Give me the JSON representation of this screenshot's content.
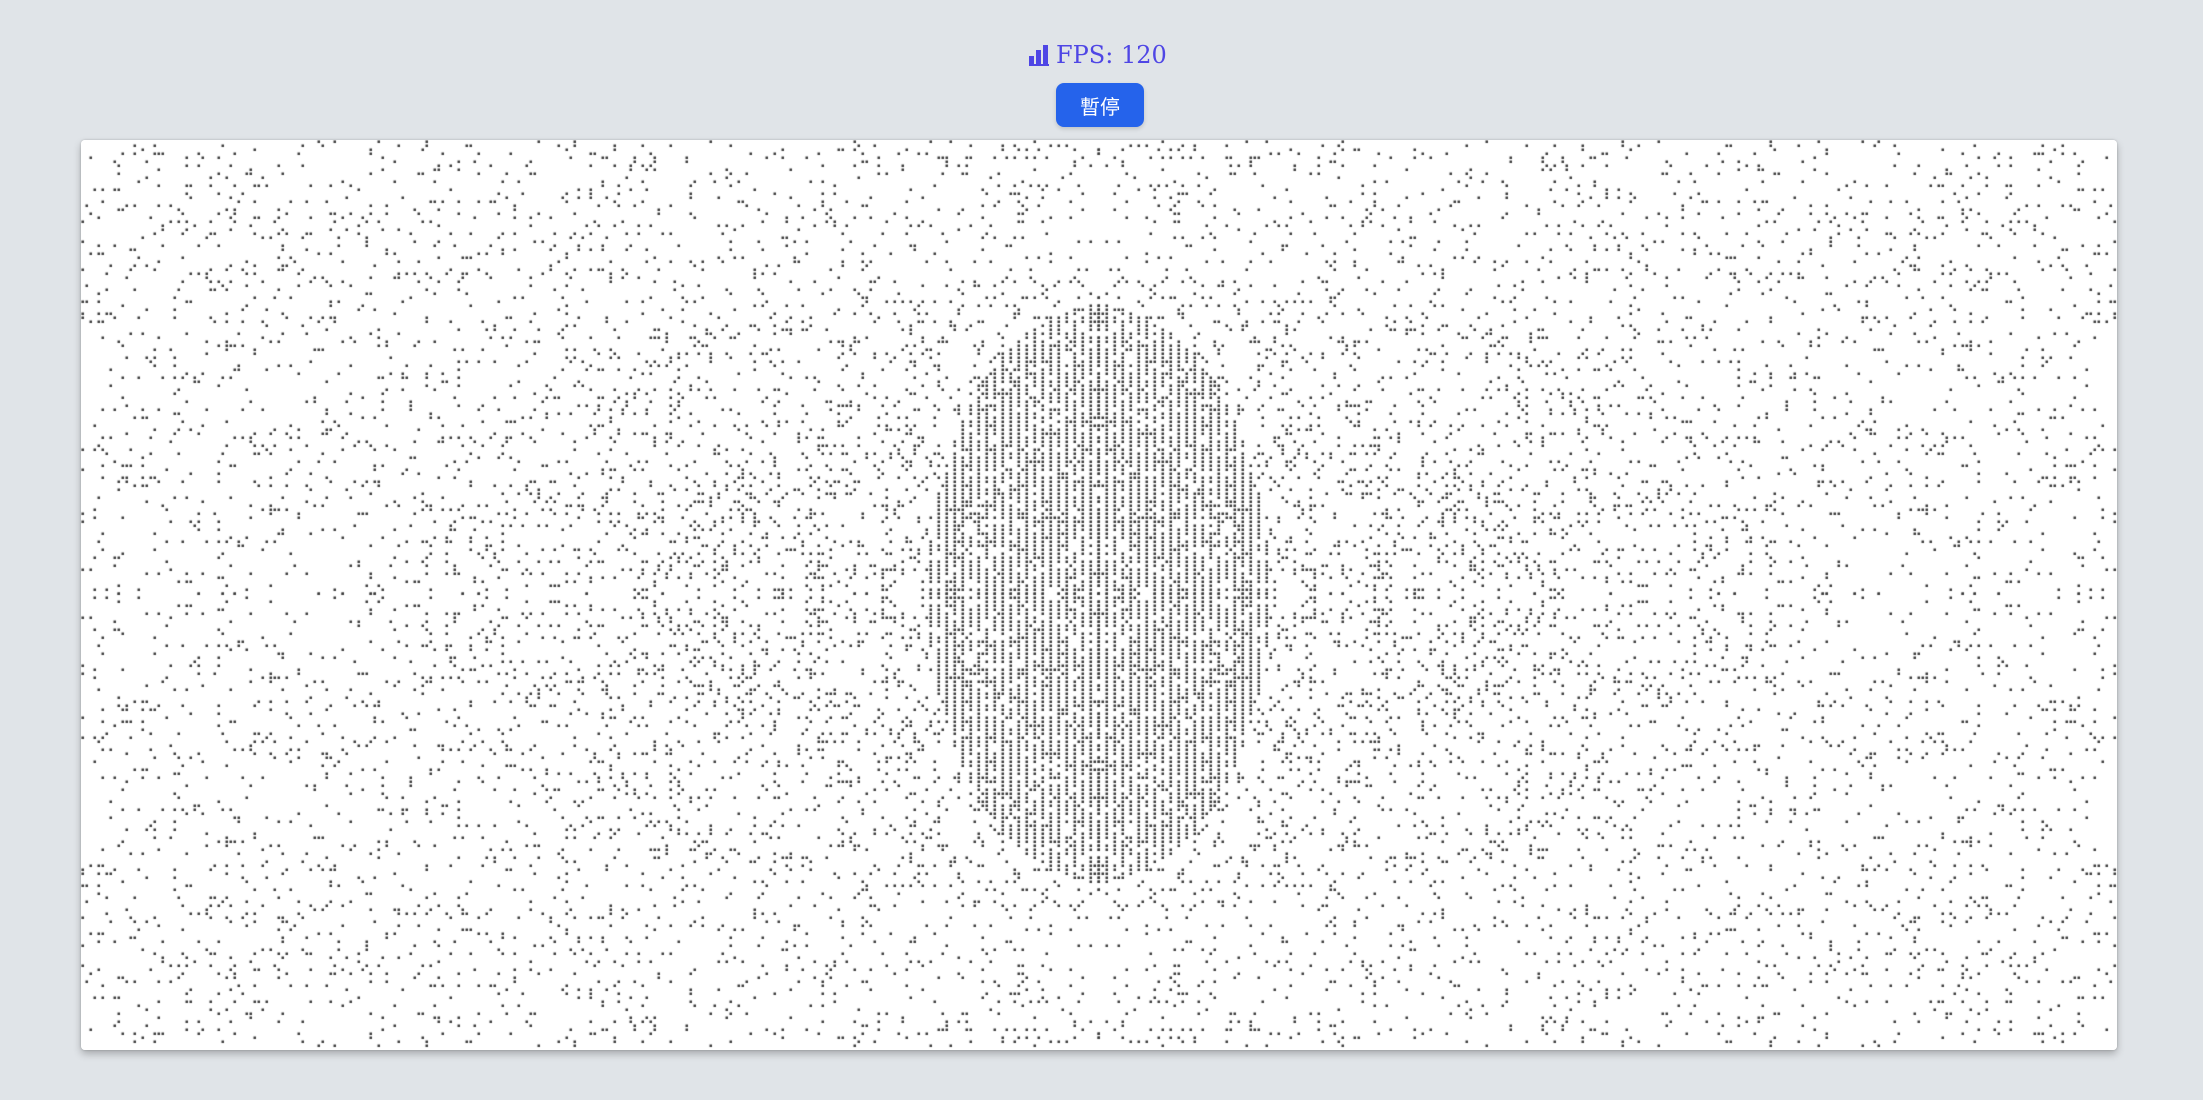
{
  "header": {
    "fps_label": "FPS: 120",
    "fps_icon": "bar-chart-icon",
    "pause_label": "暫停"
  },
  "colors": {
    "background": "#e0e4e8",
    "accent_text": "#4f46e5",
    "button": "#2563eb",
    "cell_alive": "#3a3a3a",
    "board": "#ffffff"
  },
  "board": {
    "description_key": "game-of-life-grid",
    "pattern": "symmetric-radial"
  }
}
